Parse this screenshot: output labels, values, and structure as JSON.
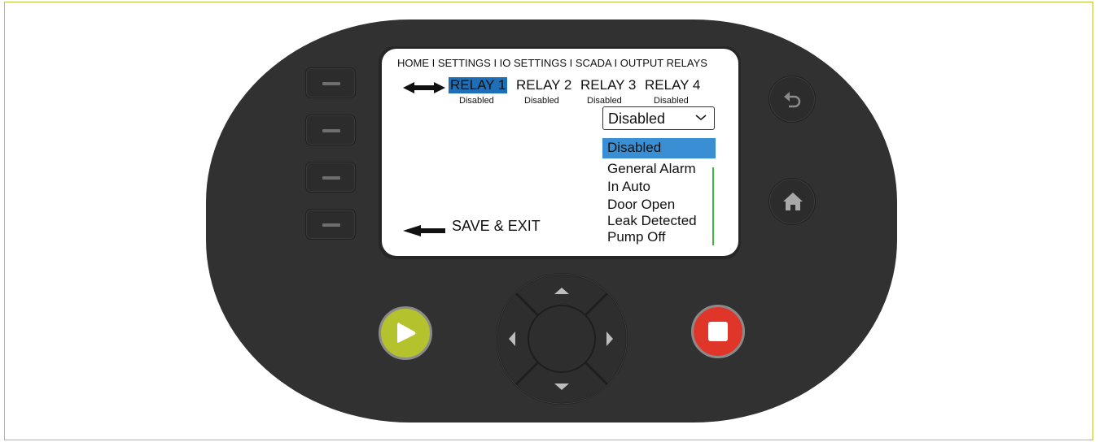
{
  "breadcrumb": "HOME I SETTINGS I IO SETTINGS I SCADA I OUTPUT RELAYS",
  "relays": [
    {
      "label": "RELAY 1",
      "status": "Disabled"
    },
    {
      "label": "RELAY 2",
      "status": "Disabled"
    },
    {
      "label": "RELAY 3",
      "status": "Disabled"
    },
    {
      "label": "RELAY 4",
      "status": "Disabled"
    }
  ],
  "selected_relay": "RELAY 1",
  "dropdown": {
    "value": "Disabled",
    "options": [
      "Disabled",
      "General Alarm",
      "In Auto",
      "Door Open",
      "Leak Detected",
      "Pump Off"
    ],
    "selected_option": "Disabled"
  },
  "save_exit_label": "SAVE & EXIT",
  "icons": {
    "back": "undo-arrow-icon",
    "home": "home-icon",
    "start": "play-icon",
    "stop": "stop-icon",
    "nav": [
      "arrow-up-icon",
      "arrow-down-icon",
      "arrow-left-icon",
      "arrow-right-icon"
    ]
  },
  "colors": {
    "device_body": "#313131",
    "highlight": "#1e6fb8",
    "option_highlight": "#3a8fd4",
    "start_button": "#b4c22e",
    "stop_button": "#e0362a",
    "scroll_indicator": "#3cb83c"
  }
}
